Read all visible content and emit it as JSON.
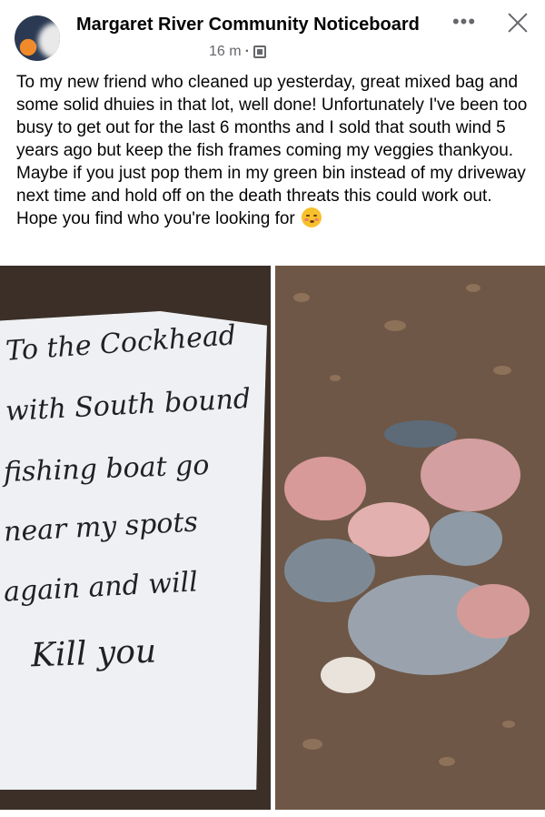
{
  "post": {
    "group_name": "Margaret River Community Noticeboard",
    "time": "16 m",
    "separator": "·",
    "more_label": "•••",
    "text": "To my new friend who cleaned up yesterday, great mixed bag and some solid dhuies in that lot, well done! Unfortunately I've been too busy to get out for the last 6 months and I sold that south wind 5 years ago but keep the fish frames coming my veggies thankyou. Maybe if you just pop them in my green bin instead of my driveway next time and hold off on the death threats this could work out. Hope you find who you're looking for",
    "emoji": "kissing-face-with-smiling-eyes"
  },
  "icons": {
    "more": "more-dots-icon",
    "close": "close-icon",
    "audience": "group-audience-icon"
  },
  "photos": {
    "note_lines": [
      "To the Cockhead",
      "with South bound",
      "fishing boat go",
      "near my spots",
      "again and will",
      "Kill you"
    ]
  }
}
